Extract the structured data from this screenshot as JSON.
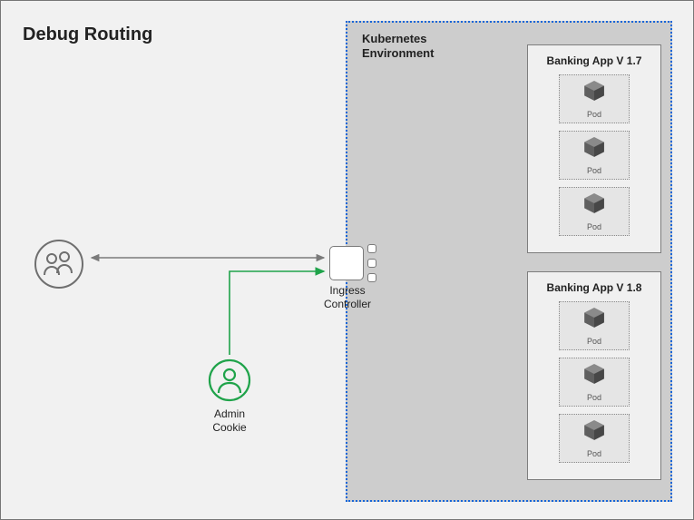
{
  "title": "Debug Routing",
  "kube_env_label_line1": "Kubernetes",
  "kube_env_label_line2": "Environment",
  "ingress_label_line1": "Ingress",
  "ingress_label_line2": "Controller",
  "admin_label_line1": "Admin",
  "admin_label_line2": "Cookie",
  "app1": {
    "title": "Banking App V 1.7",
    "pods": [
      "Pod",
      "Pod",
      "Pod"
    ]
  },
  "app2": {
    "title": "Banking App V 1.8",
    "pods": [
      "Pod",
      "Pod",
      "Pod"
    ]
  },
  "colors": {
    "normal_route": "#7a7a7a",
    "admin_route": "#1fa34a",
    "kube_border": "#1565d8"
  },
  "icons": {
    "users": "users-group-icon",
    "admin": "admin-user-icon",
    "ingress": "ingress-controller-icon",
    "pod": "cube-icon"
  }
}
